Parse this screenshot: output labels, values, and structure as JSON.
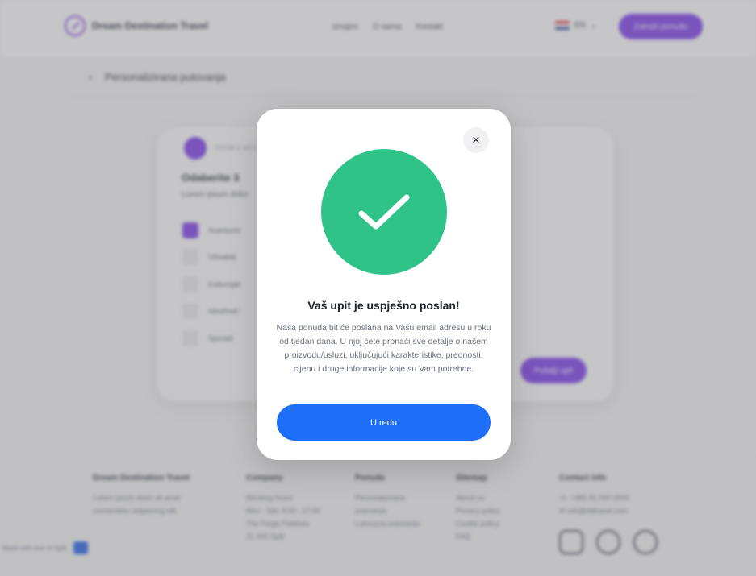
{
  "header": {
    "brand": "Dream Destination Travel",
    "nav": [
      "Iznajmi",
      "O nama",
      "Kontakt"
    ],
    "lang": "EN",
    "cta": "Zatraži ponudu"
  },
  "subheader": {
    "title": "Personalizirana putovanja"
  },
  "card": {
    "step_label": "Korak 2 od 3",
    "title": "Odaberite 3",
    "subtitle": "Lorem ipsum dolor",
    "options": [
      "Avanturist",
      "Uživatelj",
      "Kulturnjak",
      "Istraživač",
      "Sportaš"
    ],
    "send_label": "Pošalji upit"
  },
  "footer": {
    "brand": "Dream Destination Travel",
    "brand_text": "Lorem ipsum dolor sit amet consectetur adipiscing elit",
    "cols": [
      {
        "h": "Company",
        "lines": [
          "Working hours",
          "Mon - Sat: 9:00 - 17:00",
          "",
          "The Forge Fieldsea",
          "21 000 Split"
        ]
      },
      {
        "h": "Ponuda",
        "lines": [
          "Personalizirana putovanja",
          "Luksuzna putovanja"
        ]
      },
      {
        "h": "Sitemap",
        "lines": [
          "About us",
          "Privacy policy",
          "Cookie policy",
          "FAQ"
        ]
      },
      {
        "h": "Contact info",
        "lines": [
          "+385 91 000 0000",
          "info@ddtravel.com"
        ]
      }
    ],
    "chip": "Made with love in Split"
  },
  "modal": {
    "title": "Vaš upit je uspješno poslan!",
    "body": "Naša ponuda bit će poslana na Vašu email adresu u roku od tjedan dana. U njoj ćete pronaći sve detalje o našem proizvodu/usluzi, uključujući karakteristike, prednosti, cijenu i druge informacije koje su Vam potrebne.",
    "button": "U redu",
    "close_glyph": "×"
  },
  "colors": {
    "accent_purple": "#7c3aed",
    "success_green": "#2fc38a",
    "primary_blue": "#1f6ef7"
  }
}
